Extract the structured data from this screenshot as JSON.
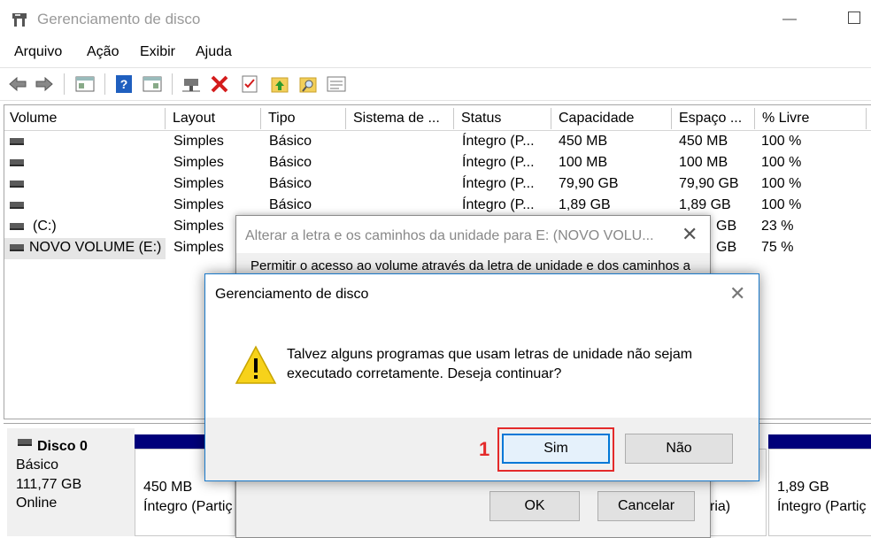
{
  "window": {
    "title": "Gerenciamento de disco"
  },
  "menu": [
    "Arquivo",
    "Ação",
    "Exibir",
    "Ajuda"
  ],
  "toolbar": {
    "icons": [
      "back-icon",
      "forward-icon",
      "properties-icon",
      "help-icon",
      "console-icon",
      "connect-icon",
      "delete-icon",
      "checklist-icon",
      "folder-up-icon",
      "search-folder-icon",
      "list-view-icon"
    ]
  },
  "table": {
    "columns": [
      "Volume",
      "Layout",
      "Tipo",
      "Sistema de ...",
      "Status",
      "Capacidade",
      "Espaço ...",
      "% Livre"
    ],
    "rows": [
      [
        "",
        "Simples",
        "Básico",
        "",
        "Íntegro (P...",
        "450 MB",
        "450 MB",
        "100 %"
      ],
      [
        "",
        "Simples",
        "Básico",
        "",
        "Íntegro (P...",
        "100 MB",
        "100 MB",
        "100 %"
      ],
      [
        "",
        "Simples",
        "Básico",
        "",
        "Íntegro (P...",
        "79,90 GB",
        "79,90 GB",
        "100 %"
      ],
      [
        "",
        "Simples",
        "Básico",
        "",
        "Íntegro (P...",
        "1,89 GB",
        "1,89 GB",
        "100 %"
      ],
      [
        "(C:)",
        "Simples",
        "",
        "",
        "",
        "",
        "GB",
        "23 %"
      ],
      [
        "NOVO VOLUME (E:)",
        "Simples",
        "",
        "",
        "",
        "",
        "GB",
        "75 %"
      ]
    ]
  },
  "disk": {
    "name": "Disco 0",
    "type": "Básico",
    "size": "111,77 GB",
    "state": "Online",
    "partitions": [
      {
        "size": "450 MB",
        "status": "Íntegro (Partiç"
      },
      {
        "size": "",
        "status": "ria)"
      },
      {
        "size": "1,89 GB",
        "status": "Íntegro (Partiç"
      }
    ]
  },
  "bg_dialog": {
    "title": "Alterar a letra e os caminhos da unidade para E: (NOVO VOLU...",
    "description": "Permitir o acesso ao volume através da letra de unidade e dos caminhos a",
    "ok": "OK",
    "cancel": "Cancelar"
  },
  "dialog": {
    "title": "Gerenciamento de disco",
    "message_line1": "Talvez alguns programas que usam letras de unidade não sejam",
    "message_line2": "executado corretamente. Deseja continuar?",
    "yes": "Sim",
    "no": "Não",
    "annotation": "1"
  },
  "colors": {
    "accent": "#1979ca",
    "annotation": "#e42a2a",
    "partition_bar": "#00007a"
  }
}
